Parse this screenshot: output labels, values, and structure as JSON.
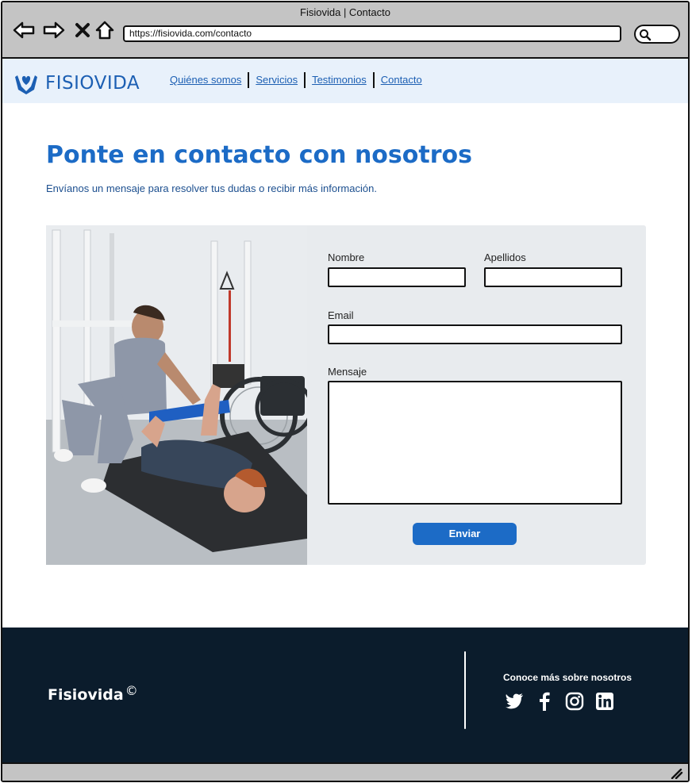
{
  "window": {
    "title": "Fisiovida | Contacto",
    "url": "https://fisiovida.com/contacto"
  },
  "header": {
    "logo_text": "FISIOVIDA",
    "nav": [
      "Quiénes somos",
      "Servicios",
      "Testimonios",
      "Contacto"
    ]
  },
  "main": {
    "title": "Ponte en contacto con nosotros",
    "subtitle": "Envíanos un mensaje para resolver tus dudas o recibir más información.",
    "form": {
      "first_name_label": "Nombre",
      "last_name_label": "Apellidos",
      "email_label": "Email",
      "message_label": "Mensaje",
      "first_name_value": "",
      "last_name_value": "",
      "email_value": "",
      "message_value": "",
      "submit_label": "Enviar"
    }
  },
  "footer": {
    "brand": "Fisiovida",
    "copyright_symbol": "©",
    "cta": "Conoce más sobre nosotros",
    "socials": [
      "twitter-icon",
      "facebook-icon",
      "instagram-icon",
      "linkedin-icon"
    ]
  },
  "colors": {
    "accent": "#1c6bc6",
    "header_bg": "#e8f1fb",
    "footer_bg": "#0b1c2c",
    "form_bg": "#e8ebee"
  }
}
